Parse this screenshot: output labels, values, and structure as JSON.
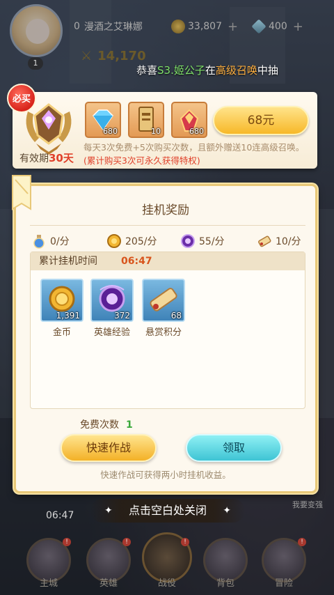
{
  "topbar": {
    "level": "1",
    "name_prefix": "0",
    "player_name": "漫酒之艾琳娜",
    "gold": "33,807",
    "diamonds": "400",
    "power": "14,170",
    "marquee": {
      "prefix": "恭喜",
      "hero": "S3.姬公子",
      "mid": "在",
      "pool": "高级召唤",
      "suffix": "中抽"
    }
  },
  "promo": {
    "must_buy_badge": "必买",
    "validity_label": "有效期",
    "validity_days": "30天",
    "rewards": [
      {
        "icon": "diamond-icon",
        "qty": "680"
      },
      {
        "icon": "summon-scroll-icon",
        "qty": "10"
      },
      {
        "icon": "crystal-box-icon",
        "qty": "680"
      }
    ],
    "price_label": "68元",
    "desc_normal": "每天3次免费+5次购买次数，且额外赠送10连高级召唤。",
    "desc_red": "(累计购买3次可永久获得特权)"
  },
  "dialog": {
    "title": "挂机奖励",
    "rates": [
      {
        "icon": "potion-icon",
        "value": "0/分"
      },
      {
        "icon": "gold-coin-icon",
        "value": "205/分"
      },
      {
        "icon": "hero-exp-icon",
        "value": "55/分"
      },
      {
        "icon": "bounty-scroll-icon",
        "value": "10/分"
      }
    ],
    "accum_label": "累计挂机时间",
    "accum_time": "06:47",
    "items": [
      {
        "icon": "gold-coin-icon",
        "count": "1,391",
        "name": "金币"
      },
      {
        "icon": "hero-exp-icon",
        "count": "372",
        "name": "英雄经验"
      },
      {
        "icon": "bounty-scroll-icon",
        "count": "68",
        "name": "悬赏积分"
      }
    ],
    "free_label": "免费次数",
    "free_count": "1",
    "quick_battle": "快速作战",
    "claim": "领取",
    "hint": "快速作战可获得两小时挂机收益。"
  },
  "close_tip": "点击空白处关闭",
  "background": {
    "timer": "06:47",
    "right_text": "我要变强"
  },
  "nav": [
    {
      "icon": "castle-icon",
      "label": "主城"
    },
    {
      "icon": "hero-icon",
      "label": "英雄"
    },
    {
      "icon": "battle-icon",
      "label": "战役"
    },
    {
      "icon": "backpack-icon",
      "label": "背包"
    },
    {
      "icon": "adventure-icon",
      "label": "冒险"
    }
  ],
  "colors": {
    "accent_gold": "#f3b127",
    "accent_cyan": "#3ec4d4",
    "highlight_red": "#e0402a",
    "time_orange": "#d8541c",
    "free_green": "#3aa83a"
  }
}
